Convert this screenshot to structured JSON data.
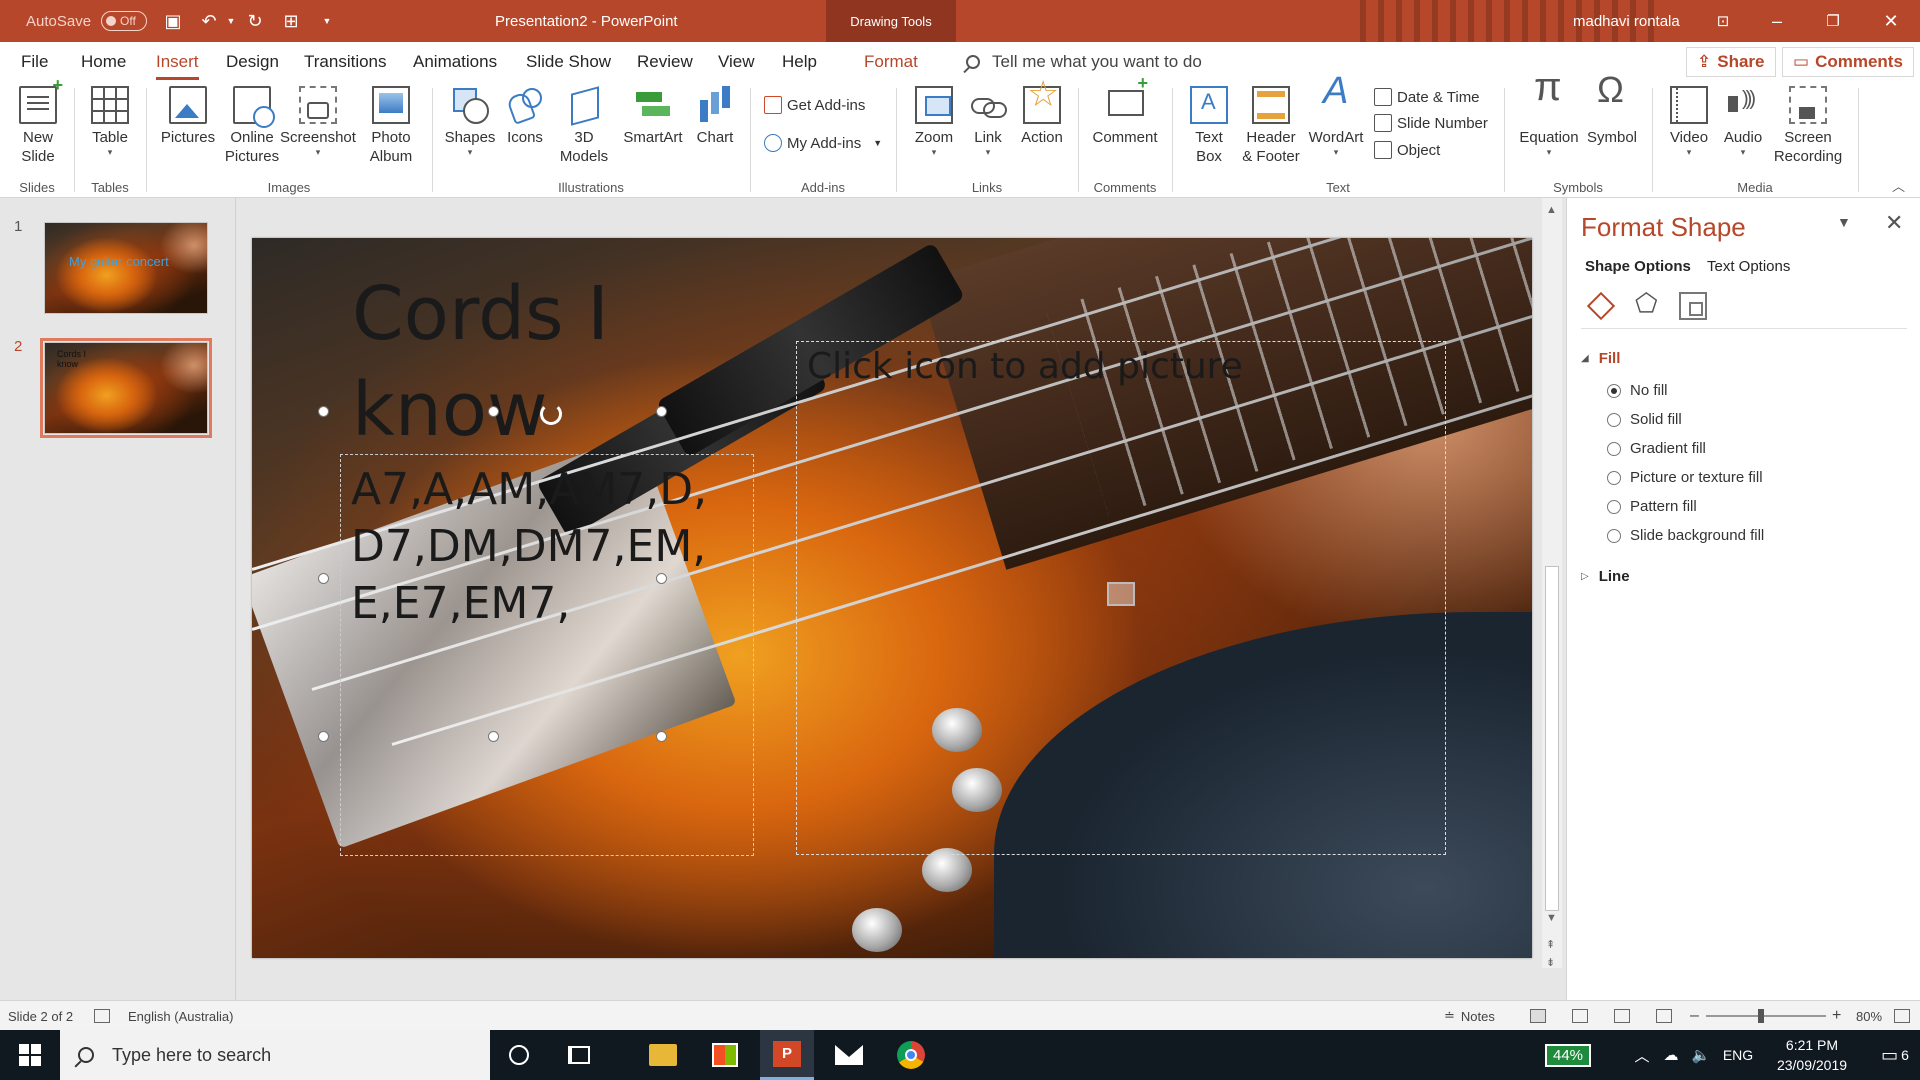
{
  "titlebar": {
    "autosave_label": "AutoSave",
    "autosave_state": "Off",
    "title": "Presentation2 - PowerPoint",
    "context_tab": "Drawing Tools",
    "user": "madhavi rontala",
    "accent": "#b7472a"
  },
  "menu": {
    "tabs": [
      "File",
      "Home",
      "Insert",
      "Design",
      "Transitions",
      "Animations",
      "Slide Show",
      "Review",
      "View",
      "Help",
      "Format"
    ],
    "active_tab": "Insert",
    "tell_me": "Tell me what you want to do",
    "share": "Share",
    "comments": "Comments"
  },
  "ribbon": {
    "slides": {
      "new_slide_1": "New",
      "new_slide_2": "Slide",
      "group": "Slides"
    },
    "tables": {
      "table": "Table",
      "group": "Tables"
    },
    "images": {
      "pictures": "Pictures",
      "online_1": "Online",
      "online_2": "Pictures",
      "screenshot": "Screenshot",
      "album_1": "Photo",
      "album_2": "Album",
      "group": "Images"
    },
    "illustrations": {
      "shapes": "Shapes",
      "icons": "Icons",
      "models_1": "3D",
      "models_2": "Models",
      "smartart": "SmartArt",
      "chart": "Chart",
      "group": "Illustrations"
    },
    "addins": {
      "get": "Get Add-ins",
      "my": "My Add-ins",
      "group": "Add-ins"
    },
    "links": {
      "zoom": "Zoom",
      "link": "Link",
      "action": "Action",
      "group": "Links"
    },
    "comments": {
      "comment": "Comment",
      "group": "Comments"
    },
    "text": {
      "textbox_1": "Text",
      "textbox_2": "Box",
      "header_1": "Header",
      "header_2": "& Footer",
      "wordart": "WordArt",
      "datetime": "Date & Time",
      "slidenum": "Slide Number",
      "object": "Object",
      "group": "Text"
    },
    "symbols": {
      "equation": "Equation",
      "symbol": "Symbol",
      "group": "Symbols"
    },
    "media": {
      "video": "Video",
      "audio": "Audio",
      "rec_1": "Screen",
      "rec_2": "Recording",
      "group": "Media"
    }
  },
  "thumbnails": {
    "items": [
      {
        "num": "1",
        "text": "My guitar concert"
      },
      {
        "num": "2",
        "text": "Cords I know"
      }
    ],
    "active": 2
  },
  "slide": {
    "title": "Cords I know",
    "chords": "A7,A,AM,AM7,D, D7,DM,DM7,EM, E,E7,EM7,",
    "picture_placeholder": "Click icon to add picture"
  },
  "format_pane": {
    "title": "Format Shape",
    "tabs": [
      "Shape Options",
      "Text Options"
    ],
    "fill_section": "Fill",
    "fill_options": [
      "No fill",
      "Solid fill",
      "Gradient fill",
      "Picture or texture fill",
      "Pattern fill",
      "Slide background fill"
    ],
    "selected_fill": "No fill",
    "line_section": "Line"
  },
  "statusbar": {
    "slide_info": "Slide 2 of 2",
    "language": "English (Australia)",
    "notes": "Notes",
    "zoom": "80%"
  },
  "taskbar": {
    "search_placeholder": "Type here to search",
    "battery": "44%",
    "language": "ENG",
    "time": "6:21 PM",
    "date": "23/09/2019",
    "notifications": "6"
  }
}
